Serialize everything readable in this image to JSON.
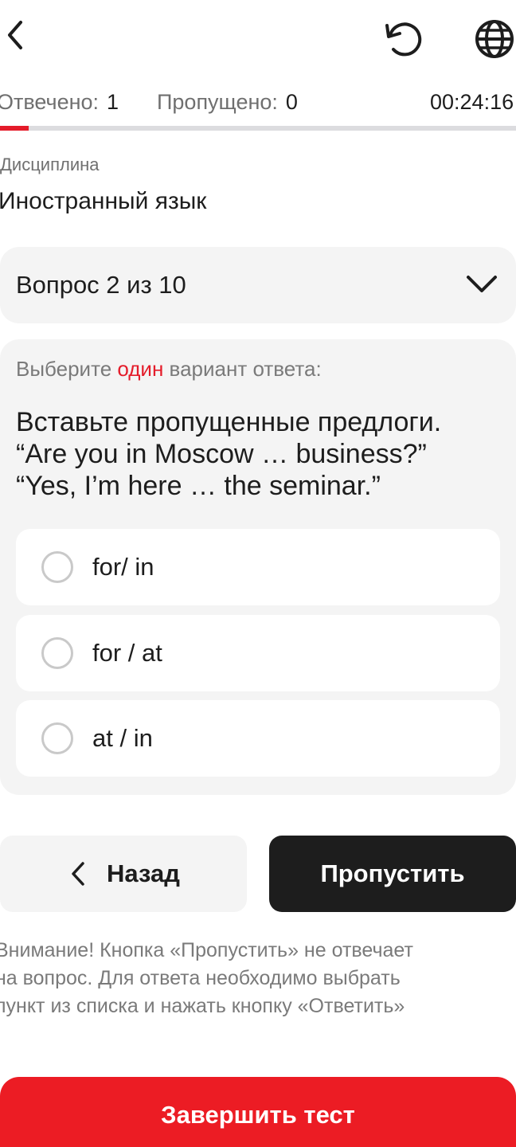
{
  "header": {
    "back_icon": "chevron-left-icon",
    "reset_icon": "reset-icon",
    "language_icon": "globe-icon"
  },
  "stats": {
    "answered_label": "Отвечено:",
    "answered_value": "1",
    "skipped_label": "Пропущено:",
    "skipped_value": "0",
    "timer": "00:24:16"
  },
  "progress": {
    "fraction": 0.055,
    "color": "#e41c2a"
  },
  "discipline": {
    "label": "Дисциплина",
    "value": "Иностранный язык"
  },
  "question_select": {
    "label": "Вопрос 2 из 10"
  },
  "question": {
    "instruction_before": "Выберите ",
    "instruction_accent": "один",
    "instruction_after": " вариант ответа:",
    "lines": [
      "Вставьте пропущенные предлоги.",
      "“Are you in Moscow … business?”",
      "“Yes, I’m here … the seminar.”"
    ],
    "options": [
      {
        "label": "for/ in",
        "selected": false
      },
      {
        "label": "for / at",
        "selected": false
      },
      {
        "label": "at / in",
        "selected": false
      }
    ]
  },
  "actions": {
    "back_label": "Назад",
    "skip_label": "Пропустить",
    "finish_label": "Завершить тест"
  },
  "warning": {
    "lines": [
      "Внимание! Кнопка «Пропустить» не отвечает",
      "на вопрос. Для ответа необходимо выбрать",
      "пункт из списка и нажать кнопку «Ответить»"
    ]
  },
  "colors": {
    "accent_red": "#ec1c24",
    "dark": "#1d1d1d",
    "muted": "#7a7a7a",
    "panel": "#f4f4f4"
  }
}
